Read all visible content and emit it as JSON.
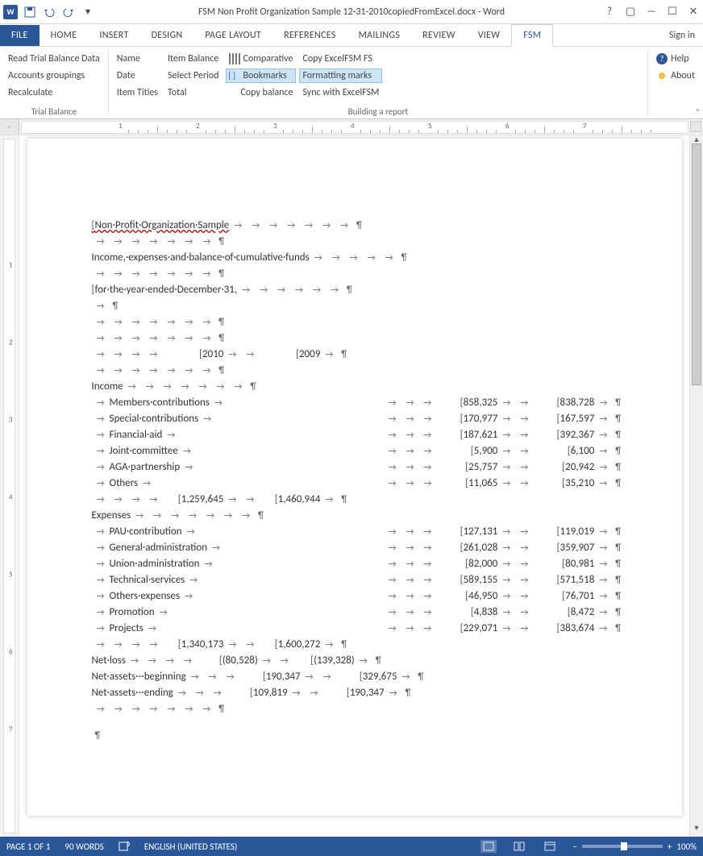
{
  "titlebar": {
    "app_hint": "W",
    "title": "FSM Non Profit Organization Sample 12-31-2010copiedFromExcel.docx - Word"
  },
  "tabs": {
    "file": "FILE",
    "home": "HOME",
    "insert": "INSERT",
    "design": "DESIGN",
    "page_layout": "PAGE LAYOUT",
    "references": "REFERENCES",
    "mailings": "MAILINGS",
    "review": "REVIEW",
    "view": "VIEW",
    "fsm": "FSM",
    "signin": "Sign in"
  },
  "ribbon": {
    "group_trial": {
      "read": "Read Trial Balance Data",
      "groupings": "Accounts groupings",
      "recalc": "Recalculate",
      "label": "Trial Balance"
    },
    "group_build": {
      "name": "Name",
      "date": "Date",
      "item_titles": "Item Titles",
      "item_balance": "Item Balance",
      "select_period": "Select Period",
      "total": "Total",
      "comparative": "Comparative",
      "bookmarks": "Bookmarks",
      "copy_balance": "Copy balance",
      "copy_fs": "Copy ExcelFSM FS",
      "formatting": "Formatting marks",
      "sync": "Sync with ExcelFSM",
      "label": "Building a report"
    },
    "group_help": {
      "help": "Help",
      "about": "About"
    }
  },
  "doc": {
    "title_line": "Non·Profit·Organization·Sample",
    "subtitle": "Income,·expenses·and·balance·of·cumulative·funds",
    "period": "for·the·year·ended·December·31,",
    "year_a": "2010",
    "year_b": "2009",
    "section_income": "Income",
    "section_expenses": "Expenses",
    "section_netloss": "Net·loss",
    "section_nab": "Net·assets·-·beginning",
    "section_nae": "Net·assets·-·ending",
    "income": [
      {
        "label": "Members·contributions",
        "a": "858,325",
        "b": "838,728"
      },
      {
        "label": "Special·contributions",
        "a": "170,977",
        "b": "167,597"
      },
      {
        "label": "Financial·aid",
        "a": "187,621",
        "b": "392,367"
      },
      {
        "label": "Joint·committee",
        "a": "5,900",
        "b": "6,100"
      },
      {
        "label": "AGA·partnership",
        "a": "25,757",
        "b": "20,942"
      },
      {
        "label": "Others",
        "a": "11,065",
        "b": "35,210"
      }
    ],
    "income_total": {
      "a": "1,259,645",
      "b": "1,460,944"
    },
    "expenses": [
      {
        "label": "PAU·contribution",
        "a": "127,131",
        "b": "119,019"
      },
      {
        "label": "General·administration",
        "a": "261,028",
        "b": "359,907"
      },
      {
        "label": "Union·administration",
        "a": "82,000",
        "b": "80,981"
      },
      {
        "label": "Technical·services",
        "a": "589,155",
        "b": "571,518"
      },
      {
        "label": "Others·expenses",
        "a": "46,950",
        "b": "76,701"
      },
      {
        "label": "Promotion",
        "a": "4,838",
        "b": "8,472"
      },
      {
        "label": "Projects",
        "a": "229,071",
        "b": "383,674"
      }
    ],
    "expenses_total": {
      "a": "1,340,173",
      "b": "1,600,272"
    },
    "netloss": {
      "a": "(80,528)",
      "b": "(139,328)"
    },
    "nab": {
      "a": "190,347",
      "b": "329,675"
    },
    "nae": {
      "a": "109,819",
      "b": "190,347"
    }
  },
  "status": {
    "page": "PAGE 1 OF 1",
    "words": "90 WORDS",
    "lang": "ENGLISH (UNITED STATES)",
    "zoom": "100%"
  }
}
